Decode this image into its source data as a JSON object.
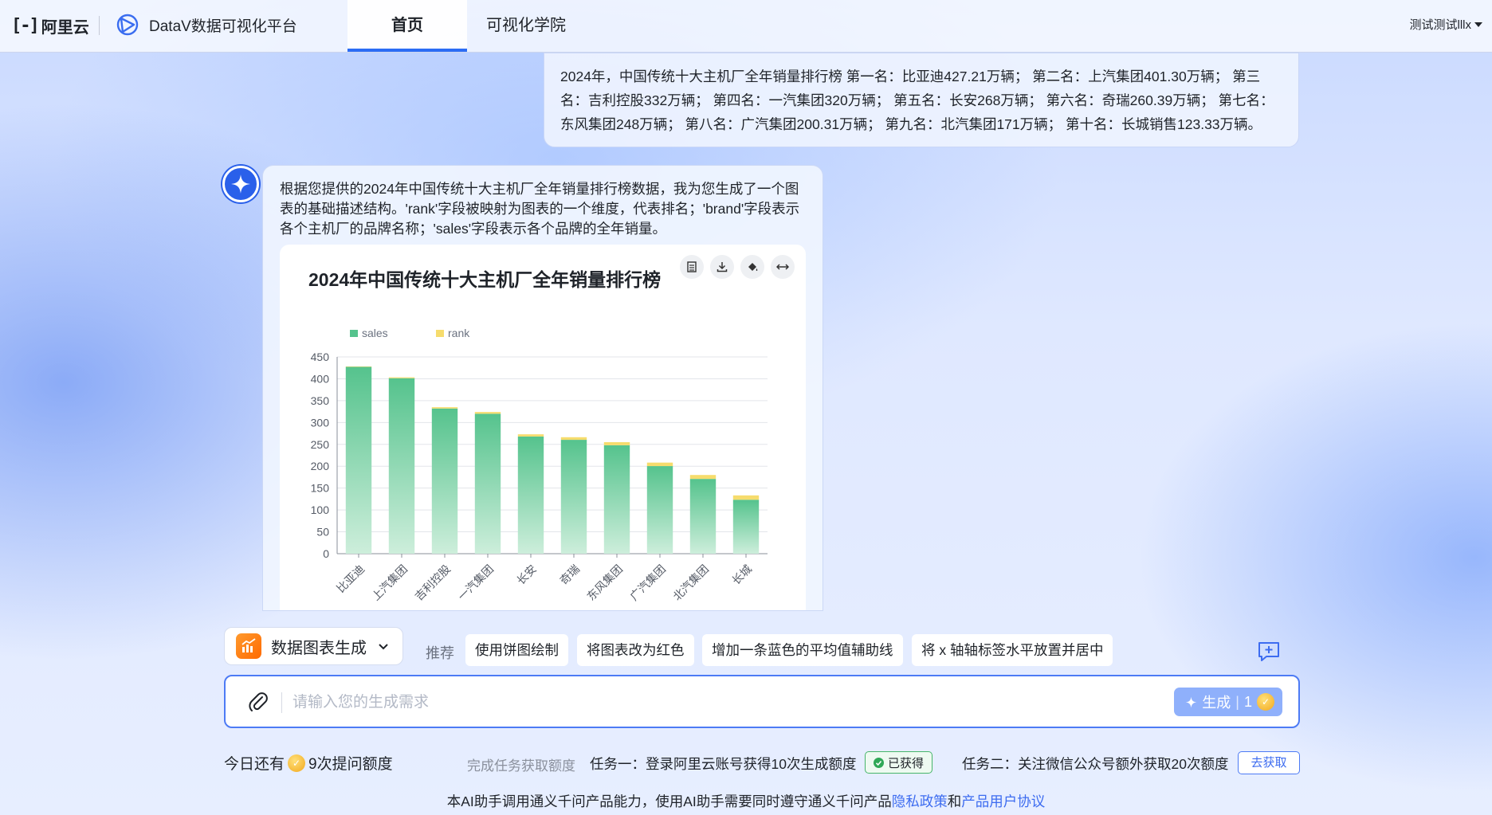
{
  "header": {
    "aliyun_logo": "阿里云",
    "datav_logo": "DataV数据可视化平台",
    "tabs": [
      {
        "label": "首页"
      },
      {
        "label": "可视化学院"
      }
    ],
    "user_name": "测试测试lllx"
  },
  "conversation": {
    "user_message": "2024年，中国传统十大主机厂全年销量排行榜 第一名：比亚迪427.21万辆； 第二名：上汽集团401.30万辆； 第三名：吉利控股332万辆； 第四名：一汽集团320万辆； 第五名：长安268万辆； 第六名：奇瑞260.39万辆； 第七名：东风集团248万辆； 第八名：广汽集团200.31万辆； 第九名：北汽集团171万辆； 第十名：长城销售123.33万辆。",
    "assistant_message": "根据您提供的2024年中国传统十大主机厂全年销量排行榜数据，我为您生成了一个图表的基础描述结构。'rank'字段被映射为图表的一个维度，代表排名；'brand'字段表示各个主机厂的品牌名称；'sales'字段表示各个品牌的全年销量。"
  },
  "chart_data": {
    "type": "bar",
    "title": "2024年中国传统十大主机厂全年销量排行榜",
    "categories": [
      "比亚迪",
      "上汽集团",
      "吉利控股",
      "一汽集团",
      "长安",
      "奇瑞",
      "东风集团",
      "广汽集团",
      "北汽集团",
      "长城"
    ],
    "series": [
      {
        "name": "sales",
        "values": [
          427.21,
          401.3,
          332,
          320,
          268,
          260.39,
          248,
          200.31,
          171,
          123.33
        ],
        "color": "#55c38d"
      },
      {
        "name": "rank",
        "values": [
          1,
          2,
          3,
          4,
          5,
          6,
          7,
          8,
          9,
          10
        ],
        "color": "#f6dc6d"
      }
    ],
    "stacked": true,
    "ylim": [
      0,
      450
    ],
    "yticks": [
      0,
      50,
      100,
      150,
      200,
      250,
      300,
      350,
      400,
      450
    ],
    "legend_position": "top-left",
    "grid": true
  },
  "composer": {
    "mode_label": "数据图表生成",
    "recommend_label": "推荐",
    "suggestions": [
      "使用饼图绘制",
      "将图表改为红色",
      "增加一条蓝色的平均值辅助线",
      "将 x 轴轴标签水平放置并居中"
    ],
    "input_placeholder": "请输入您的生成需求",
    "generate_label": "生成",
    "generate_cost": "1"
  },
  "quota": {
    "today_prefix": "今日还有",
    "today_suffix": "9次提问额度",
    "task_hint": "完成任务获取额度",
    "task1": "任务一：登录阿里云账号获得10次生成额度",
    "task1_status": "已获得",
    "task2": "任务二：关注微信公众号额外获取20次额度",
    "task2_button": "去获取"
  },
  "footer": {
    "text_before": "本AI助手调用通义千问产品能力，使用AI助手需要同时遵守通义千问产品",
    "privacy_link": "隐私政策",
    "and": "和",
    "agreement_link": "产品用户协议"
  },
  "colors": {
    "accent": "#2b6cf5",
    "bar_sales": "#55c38d",
    "bar_rank": "#f6dc6d"
  }
}
